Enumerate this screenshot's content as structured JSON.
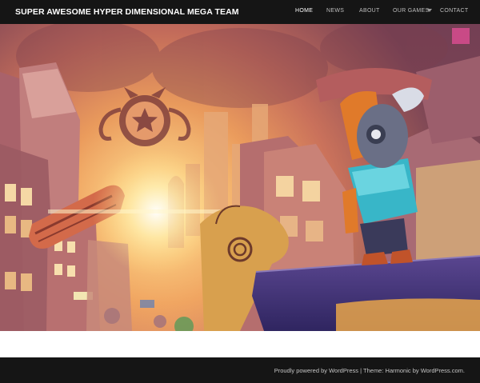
{
  "site": {
    "title": "SUPER AWESOME HYPER DIMENSIONAL MEGA TEAM"
  },
  "nav": {
    "items": [
      {
        "label": "HOME",
        "active": true
      },
      {
        "label": "NEWS",
        "active": false
      },
      {
        "label": "ABOUT",
        "active": false
      },
      {
        "label": "OUR GAMES",
        "active": false,
        "has_submenu": true
      },
      {
        "label": "CONTACT",
        "active": false
      }
    ]
  },
  "hero": {
    "description_icon": "star-emblem-icon"
  },
  "footer": {
    "powered_text": "Proudly powered by WordPress",
    "separator": " | ",
    "theme_text": "Theme: Harmonic by WordPress.com."
  },
  "colors": {
    "bar_background": "#151515",
    "nav_active": "#ffffff",
    "nav_inactive": "#bdbdbd",
    "hero_glow": "#ffd27a",
    "hero_purple": "#4a3a78"
  }
}
